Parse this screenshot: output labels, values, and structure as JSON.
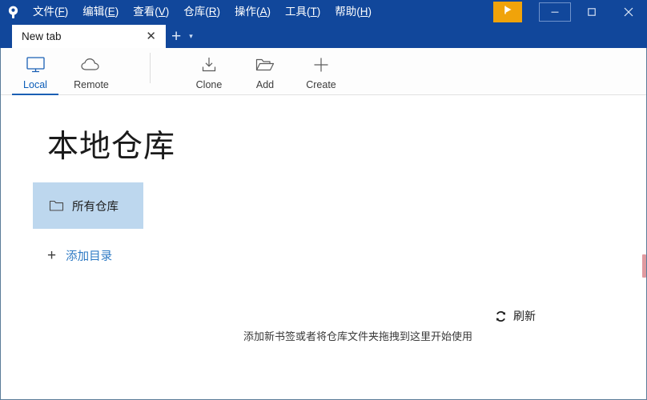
{
  "window": {
    "logo_icon": "sourcetree-logo-icon",
    "titlebar_color": "#11479b",
    "accent_orange": "#f0a30a",
    "link_blue": "#2e7ac4"
  },
  "menubar": {
    "items": [
      {
        "label": "文件",
        "accel": "F",
        "name": "menu-file"
      },
      {
        "label": "编辑",
        "accel": "E",
        "name": "menu-edit"
      },
      {
        "label": "查看",
        "accel": "V",
        "name": "menu-view"
      },
      {
        "label": "仓库",
        "accel": "R",
        "name": "menu-repository"
      },
      {
        "label": "操作",
        "accel": "A",
        "name": "menu-actions"
      },
      {
        "label": "工具",
        "accel": "T",
        "name": "menu-tools"
      },
      {
        "label": "帮助",
        "accel": "H",
        "name": "menu-help"
      }
    ]
  },
  "window_controls": {
    "flag_icon": "flag-icon",
    "minimize": "—",
    "maximize": "▢",
    "close": "✕"
  },
  "tabs": {
    "items": [
      {
        "label": "New tab",
        "close": "✕"
      }
    ],
    "add_label": "+",
    "caret_label": "▾"
  },
  "toolbar": {
    "items": [
      {
        "label": "Local",
        "icon": "monitor-icon",
        "active": true
      },
      {
        "label": "Remote",
        "icon": "cloud-icon",
        "active": false
      },
      {
        "label": "Clone",
        "icon": "download-icon",
        "active": false
      },
      {
        "label": "Add",
        "icon": "folder-open-icon",
        "active": false
      },
      {
        "label": "Create",
        "icon": "plus-icon",
        "active": false
      }
    ]
  },
  "main": {
    "page_title": "本地仓库",
    "bookmark": {
      "label": "所有仓库",
      "icon": "folder-icon"
    },
    "add_directory": {
      "label": "添加目录",
      "plus": "+"
    },
    "hint": "添加新书签或者将仓库文件夹拖拽到这里开始使用",
    "refresh": {
      "label": "刷新",
      "icon": "refresh-icon"
    }
  }
}
